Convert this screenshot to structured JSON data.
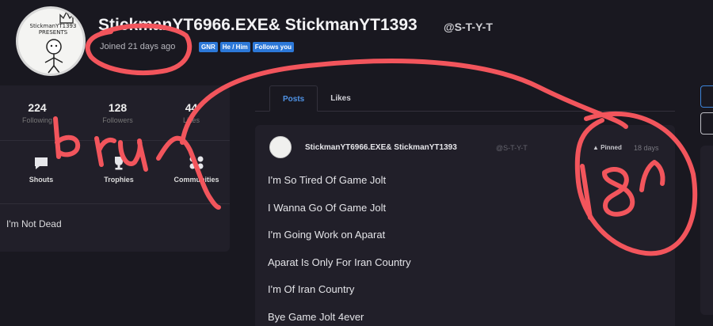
{
  "profile": {
    "avatar_caption": "StickmanYT1393 PRESENTS",
    "name": "StickmanYT6966.EXE& StickmanYT1393",
    "handle": "@S-T-Y-T",
    "joined": "Joined 21 days ago",
    "badges": [
      "GNR",
      "He / Him",
      "Follows you"
    ]
  },
  "stats": [
    {
      "value": "224",
      "label": "Following"
    },
    {
      "value": "128",
      "label": "Followers"
    },
    {
      "value": "44",
      "label": "Likes"
    }
  ],
  "nav": [
    {
      "label": "Shouts",
      "icon": "chat-bubble-icon"
    },
    {
      "label": "Trophies",
      "icon": "trophy-icon"
    },
    {
      "label": "Communities",
      "icon": "communities-icon"
    }
  ],
  "bio": "I'm Not Dead",
  "tabs": [
    "Posts",
    "Likes"
  ],
  "post": {
    "author": "StickmanYT6966.EXE& StickmanYT1393",
    "handle": "@S-T-Y-T",
    "pinned": "Pinned",
    "time": "18 days",
    "lines": [
      "I'm So Tired Of Game Jolt",
      "I Wanna Go Of Game Jolt",
      "I'm Going Work on Aparat",
      "Aparat Is Only For Iran Country",
      "I'm Of Iran Country",
      "Bye Game Jolt 4ever"
    ]
  },
  "annotations": {
    "color": "#f2555c",
    "left_text": "bru",
    "right_text": "18"
  },
  "colors": {
    "accent": "#2c78d8",
    "background": "#191820",
    "card": "#211f29"
  }
}
